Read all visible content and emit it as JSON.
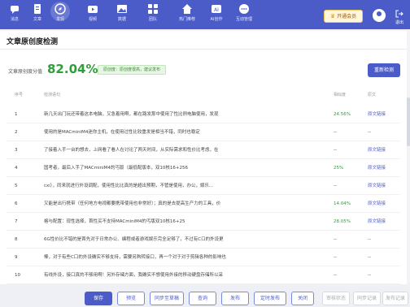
{
  "nav": {
    "items": [
      {
        "label": "消息",
        "icon": "chat-icon"
      },
      {
        "label": "文章",
        "icon": "document-icon"
      },
      {
        "label": "发现",
        "icon": "compass-icon"
      },
      {
        "label": "视频",
        "icon": "video-icon"
      },
      {
        "label": "数据",
        "icon": "image-icon"
      },
      {
        "label": "团队",
        "icon": "grid-icon"
      },
      {
        "label": "热门推荐",
        "icon": "home-icon"
      },
      {
        "label": "AI创作",
        "icon": "ai-icon"
      },
      {
        "label": "互动管理",
        "icon": "comment-icon"
      }
    ],
    "vip_label": "开通会员",
    "exit_label": "退出"
  },
  "panel": {
    "title": "文章原创度检测",
    "score_label": "文章原创度分值",
    "score_value": "82.04%",
    "score_tip": "原创度：原创度很高，建议发布",
    "recheck_label": "重新检测"
  },
  "table": {
    "headers": {
      "no": "序号",
      "text": "检测语句",
      "sim": "相似度",
      "src": "原文"
    },
    "rows": [
      {
        "no": "1",
        "text": "新几天出门玩还带着这本电脑，又急着用啊，都在路发那中使用了性比例电脑使用，发现",
        "sim": "24.56%",
        "src": "原文链接",
        "green": true,
        "link": true
      },
      {
        "no": "2",
        "text": "使用的是MACminiM4迷你主机，在使用过性比较重发是相当不错，同时也稳定",
        "sim": "--",
        "src": "--",
        "green": false,
        "link": false
      },
      {
        "no": "3",
        "text": "了接着入手一台的想去，上网看了看人在讨论了两天时间，从实际需求和性价比考虑，在",
        "sim": "--",
        "src": "原文链接",
        "green": false,
        "link": true
      },
      {
        "no": "4",
        "text": "国考者，最后入手了MACminiM4的丐版（最低配版本，双10核16+256",
        "sim": "25%",
        "src": "原文链接",
        "green": true,
        "link": true
      },
      {
        "no": "5",
        "text": "cxi），同来就进行外设调配，使用性比比真的是超出预期，不管是使用，办公，娱乐...",
        "sim": "--",
        "src": "原文链接",
        "green": false,
        "link": true
      },
      {
        "no": "6",
        "text": "又能是出行携带（任何地方电视都要携带使用也非常好）；真的是去提高生产力的工具，价",
        "sim": "14.04%",
        "src": "原文链接",
        "green": true,
        "link": true
      },
      {
        "no": "7",
        "text": "格与配置：现性选择，首性买不支持MACminiM4的丐版双10核16+25",
        "sim": "28.05%",
        "src": "原文链接",
        "green": true,
        "link": true
      },
      {
        "no": "8",
        "text": "6G性价比不错的是首先对于日常办公、编程或者游戏娱乐完全足够了，不过有C口的外设更",
        "sim": "--",
        "src": "--",
        "green": false,
        "link": false
      },
      {
        "no": "9",
        "text": "棒，对于有些C口的外设确实不够支持，需要另购转接口，再一个对于对于剪辑各种的影响也",
        "sim": "--",
        "src": "--",
        "green": false,
        "link": false
      },
      {
        "no": "10",
        "text": "有线外设，接口真的不够用啊！另外存储方面，我确实不想使用外接的移动硬盘存储所以采",
        "sim": "--",
        "src": "--",
        "green": false,
        "link": false
      }
    ]
  },
  "bottom": {
    "save": "保存",
    "preview": "预览",
    "sync": "同步至草稿",
    "publish_all": "查询",
    "publish": "发布",
    "timed": "定时发布",
    "close": "关闭",
    "review_status": "审核状态",
    "sync_record": "同步记录",
    "publish_record": "发布记录"
  },
  "colors": {
    "brand": "#4b5cc9",
    "good": "#2e9e3b"
  }
}
